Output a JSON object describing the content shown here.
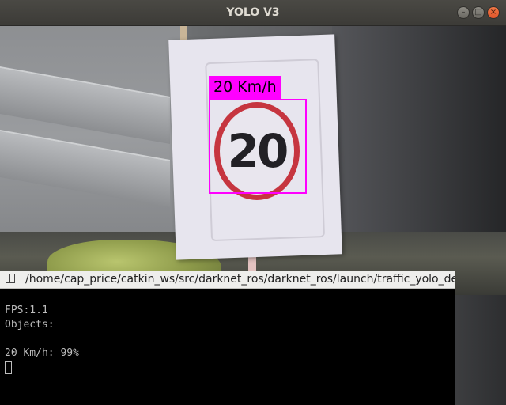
{
  "window": {
    "title": "YOLO V3",
    "controls": {
      "minimize": "–",
      "maximize": "□",
      "close": "×"
    }
  },
  "feed": {
    "sign_text": "20",
    "detection": {
      "label": "20 Km/h",
      "box_color": "#ff00ff"
    }
  },
  "terminal": {
    "title": "/home/cap_price/catkin_ws/src/darknet_ros/darknet_ros/launch/traffic_yolo_de",
    "lines": [
      "",
      "FPS:1.1",
      "Objects:",
      "",
      "20 Km/h: 99%"
    ]
  }
}
